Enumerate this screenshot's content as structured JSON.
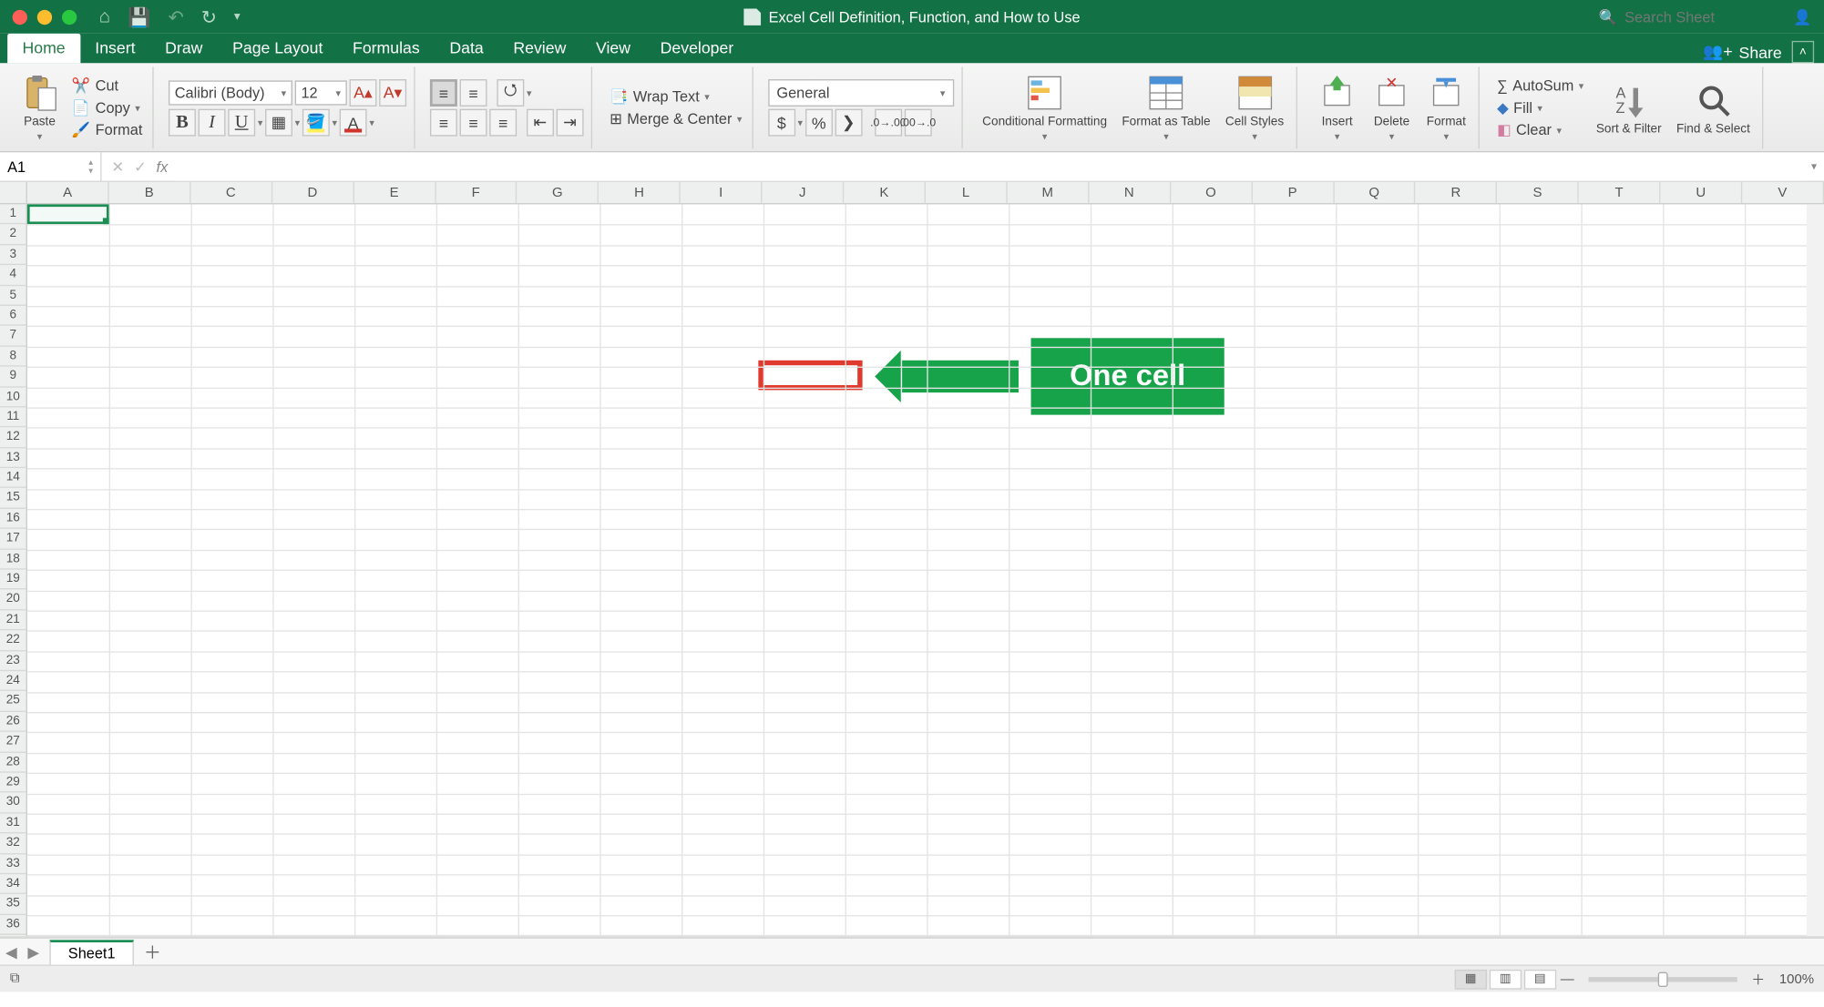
{
  "title": "Excel Cell Definition, Function, and How to Use",
  "search_placeholder": "Search Sheet",
  "share": "Share",
  "tabs": [
    "Home",
    "Insert",
    "Draw",
    "Page Layout",
    "Formulas",
    "Data",
    "Review",
    "View",
    "Developer"
  ],
  "active_tab": 0,
  "clipboard": {
    "paste": "Paste",
    "cut": "Cut",
    "copy": "Copy",
    "format": "Format"
  },
  "font": {
    "name": "Calibri (Body)",
    "size": "12",
    "increase": "A▴",
    "decrease": "A▾"
  },
  "align": {
    "wrap": "Wrap Text",
    "merge": "Merge & Center"
  },
  "number": {
    "format": "General"
  },
  "styles": {
    "cf": "Conditional Formatting",
    "fat": "Format as Table",
    "cs": "Cell Styles"
  },
  "cells": {
    "insert": "Insert",
    "delete": "Delete",
    "format": "Format"
  },
  "editing": {
    "autosum": "AutoSum",
    "fill": "Fill",
    "clear": "Clear",
    "sort": "Sort & Filter",
    "find": "Find & Select"
  },
  "namebox": "A1",
  "formula": "",
  "columns": [
    "A",
    "B",
    "C",
    "D",
    "E",
    "F",
    "G",
    "H",
    "I",
    "J",
    "K",
    "L",
    "M",
    "N",
    "O",
    "P",
    "Q",
    "R",
    "S",
    "T",
    "U",
    "V"
  ],
  "rows_count": 36,
  "sheet_tab": "Sheet1",
  "zoom": "100%",
  "annotation": {
    "label": "One cell"
  }
}
